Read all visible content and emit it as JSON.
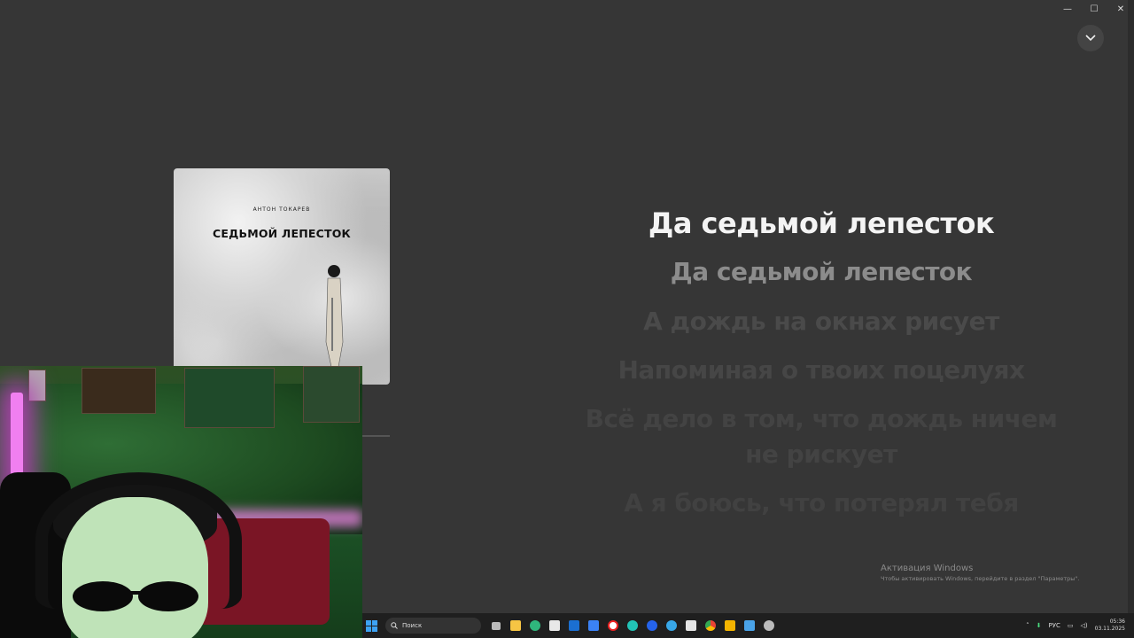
{
  "window": {
    "controls": {
      "minimize": "—",
      "maximize": "☐",
      "close": "✕"
    },
    "collapse_icon": "chevron-down-icon"
  },
  "album": {
    "artist": "АНТОН ТОКАРЕВ",
    "title": "СЕДЬМОЙ ЛЕПЕСТОК"
  },
  "lyrics": {
    "current": "Да седьмой лепесток",
    "lines": [
      "Да седьмой лепесток",
      "А дождь на окнах рисует",
      "Напоминая о твоих поцелуях",
      "Всё дело в том, что дождь ничем не рискует",
      "А я боюсь, что потерял тебя"
    ]
  },
  "activation": {
    "title": "Активация Windows",
    "subtitle": "Чтобы активировать Windows, перейдите в раздел \"Параметры\"."
  },
  "taskbar": {
    "search_placeholder": "Поиск",
    "apps": [
      "task-view",
      "file-explorer",
      "edge",
      "store",
      "outlook",
      "todo",
      "yandex",
      "copilot",
      "media",
      "telegram",
      "steam",
      "chrome",
      "winamp",
      "photos",
      "settings"
    ],
    "tray": {
      "language": "РУС",
      "time": "05:36",
      "date": "03.11.2025"
    }
  },
  "colors": {
    "background": "#363636",
    "lyric_active": "#f4f4f4",
    "lyric_next": "#8c8c8c",
    "lyric_dim": "#4a4a4a"
  }
}
